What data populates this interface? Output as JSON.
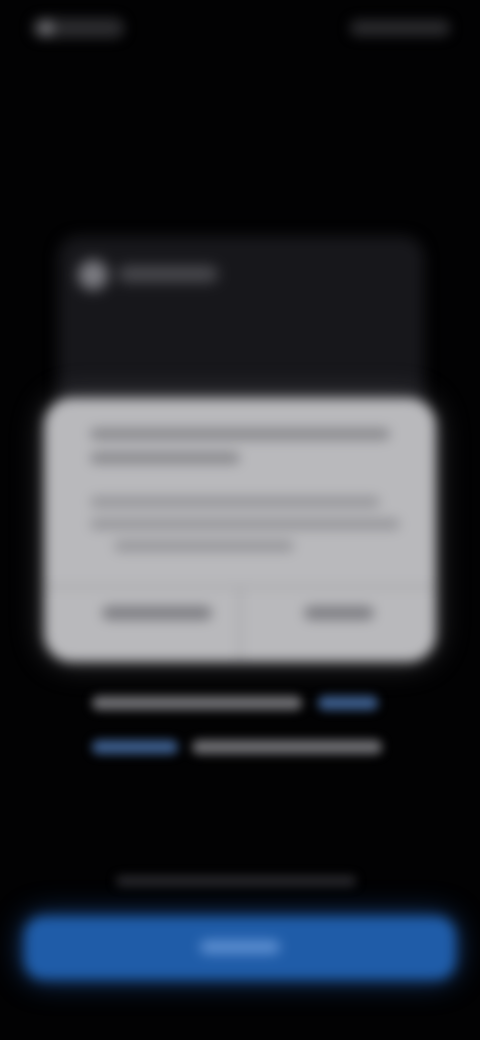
{
  "screen": {
    "background_color": "#020203",
    "accent_color": "#1f5ca8"
  },
  "status_bar": {
    "icons": [
      "status-indicator-icon"
    ]
  },
  "background_card": {
    "icon": "app-icon"
  },
  "alert": {
    "background_color": "#b9b9bc"
  },
  "primary_button": {
    "color": "#1f5ca8"
  }
}
